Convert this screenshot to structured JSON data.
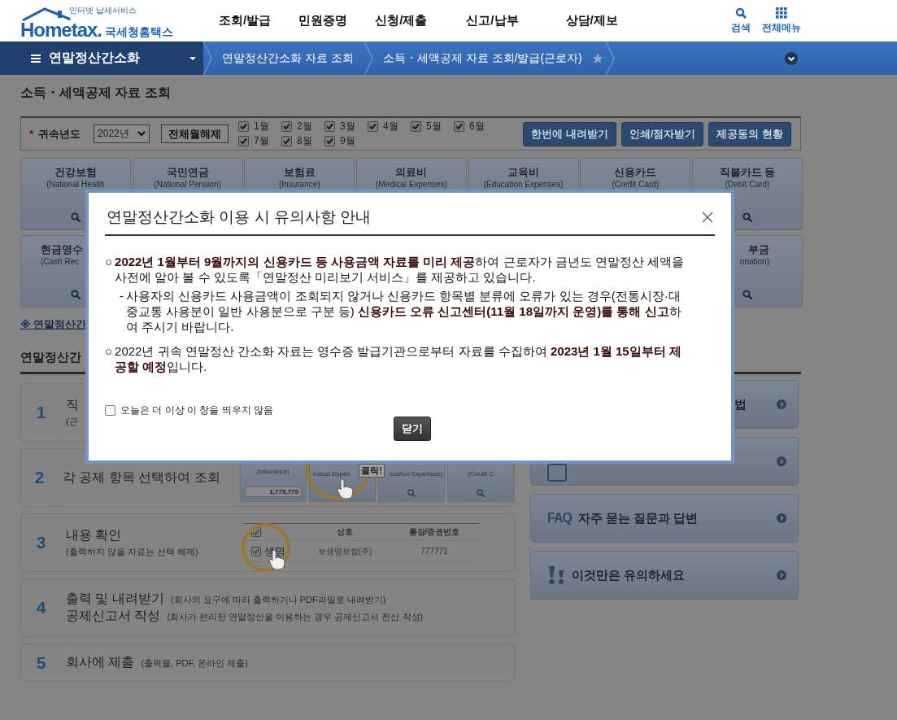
{
  "header": {
    "logo": {
      "tagline": "인터넷 납세서비스",
      "brand": "Hometax.",
      "name": "국세청홈택스"
    },
    "menu": [
      "조회/발급",
      "민원증명",
      "신청/제출",
      "신고/납부",
      "상담/제보"
    ],
    "tools": [
      {
        "kind": "search",
        "label": "검색"
      },
      {
        "kind": "grid",
        "label": "전체메뉴"
      }
    ]
  },
  "nav": {
    "section": "연말정산간소화",
    "breadcrumbs": [
      "연말정산간소화 자료 조회",
      "소득・세액공제 자료 조회/발급(근로자)"
    ],
    "favorite": false
  },
  "page": {
    "title": "소득・세액공제 자료 조회",
    "filter": {
      "required_mark": "*",
      "label": "귀속년도",
      "year": "2022년",
      "clear_button": "전체월해제",
      "months": [
        {
          "label": "1월",
          "checked": true
        },
        {
          "label": "2월",
          "checked": true
        },
        {
          "label": "3월",
          "checked": true
        },
        {
          "label": "4월",
          "checked": true
        },
        {
          "label": "5월",
          "checked": true
        },
        {
          "label": "6월",
          "checked": true
        },
        {
          "label": "7월",
          "checked": true
        },
        {
          "label": "8월",
          "checked": true
        },
        {
          "label": "9월",
          "checked": true
        }
      ],
      "buttons": [
        "한번에 내려받기",
        "인쇄/점자받기",
        "제공동의 현황"
      ]
    },
    "tile_rows": [
      [
        {
          "title": "건강보험",
          "subtitle": "(National Health",
          "search_icon": true
        },
        {
          "title": "국민연금",
          "subtitle": "(National Pension)",
          "search_icon": false
        },
        {
          "title": "보험료",
          "subtitle": "(Insurance)",
          "search_icon": false
        },
        {
          "title": "의료비",
          "subtitle": "(Medical Expenses)",
          "search_icon": false
        },
        {
          "title": "교육비",
          "subtitle": "(Education Expenses)",
          "search_icon": false
        },
        {
          "title": "신용카드",
          "subtitle": "(Credit Card)",
          "search_icon": false
        },
        {
          "title": "직불카드 등",
          "subtitle": "(Debit Card)",
          "search_icon": true
        }
      ],
      [
        {
          "title": "현금영수",
          "subtitle": "(Cash Rec",
          "search_icon": true
        },
        {
          "title": "부금",
          "subtitle": "onation)",
          "search_icon": true
        }
      ]
    ],
    "notice_link": "※ 연말정산간",
    "section_title": "연말정산간",
    "steps": [
      {
        "number": "1",
        "title": "직",
        "note": "(근"
      },
      {
        "number": "2",
        "title": "각 공제 항목 선택하여 조회",
        "illustration": {
          "kind": "tiles",
          "tiles": [
            {
              "label": "(Insurance)",
              "amount": "1,775,779",
              "highlighted": false
            },
            {
              "label": "edical Expen",
              "highlighted": true,
              "callout": "클릭!"
            },
            {
              "label": "ucation Expenses)",
              "highlighted": false
            },
            {
              "label": "(Credit C",
              "highlighted": false
            }
          ]
        }
      },
      {
        "number": "3",
        "title": "내용 확인",
        "note": "(출력하지 않을 자료는 선택 해제)",
        "illustration": {
          "kind": "table",
          "all_checked": true,
          "columns": [
            "상호",
            "통장/증권번호"
          ],
          "rows": [
            {
              "checked": true,
              "highlight": "생명",
              "cells": [
                "보생명보험(주)",
                "777771"
              ]
            }
          ]
        }
      },
      {
        "number": "4",
        "lines": [
          {
            "title": "출력 및 내려받기",
            "note": "(회사의 요구에 따라 출력하거나 PDF파일로 내려받기)"
          },
          {
            "title": "공제신고서 작성",
            "note": "(회사가 편리한 연말정산을 이용하는 경우 공제신고서 전산 작성)"
          }
        ]
      },
      {
        "number": "5",
        "title": "회사에 제출",
        "note": "(출력물, PDF, 온라인 제출)"
      }
    ],
    "side_links": [
      {
        "kind": "none",
        "label": "법"
      },
      {
        "kind": "square"
      },
      {
        "kind": "faq",
        "prefix": "FAQ",
        "label": "자주 묻는 질문과 답변"
      },
      {
        "kind": "alert",
        "label": "이것만은 유의하세요"
      }
    ]
  },
  "dialog": {
    "title": "연말정산간소화 이용 시 유의사항 안내",
    "items": [
      {
        "marker": "○",
        "text": "**2022년 1월부터 9월까지의 신용카드 등 사용금액 자료를 미리 제공**하여 근로자가 금년도 연말정산 세액을 사전에 알아 볼 수 있도록「연말정산 미리보기 서비스」를 제공하고 있습니다.",
        "children": [
          {
            "marker": "-",
            "text": "사용자의 신용카드 사용금액이 조회되지 않거나 신용카드 항목별 분류에 오류가 있는 경우(전통시장·대중교통 사용분이 일반 사용분으로 구분 등) **신용카드 오류 신고센터(11월 18일까지 운영)를 통해 신고**하여 주시기 바랍니다."
          }
        ]
      },
      {
        "marker": "○",
        "text": "2022년 귀속 연말정산 간소화 자료는 영수증 발급기관으로부터 자료를 수집하여 **2023년 1월 15일부터 제공할 예정**입니다."
      }
    ],
    "dont_show": {
      "label": "오늘은 더 이상 이 창을 띄우지 않음",
      "checked": false
    },
    "close_button": "닫기"
  }
}
